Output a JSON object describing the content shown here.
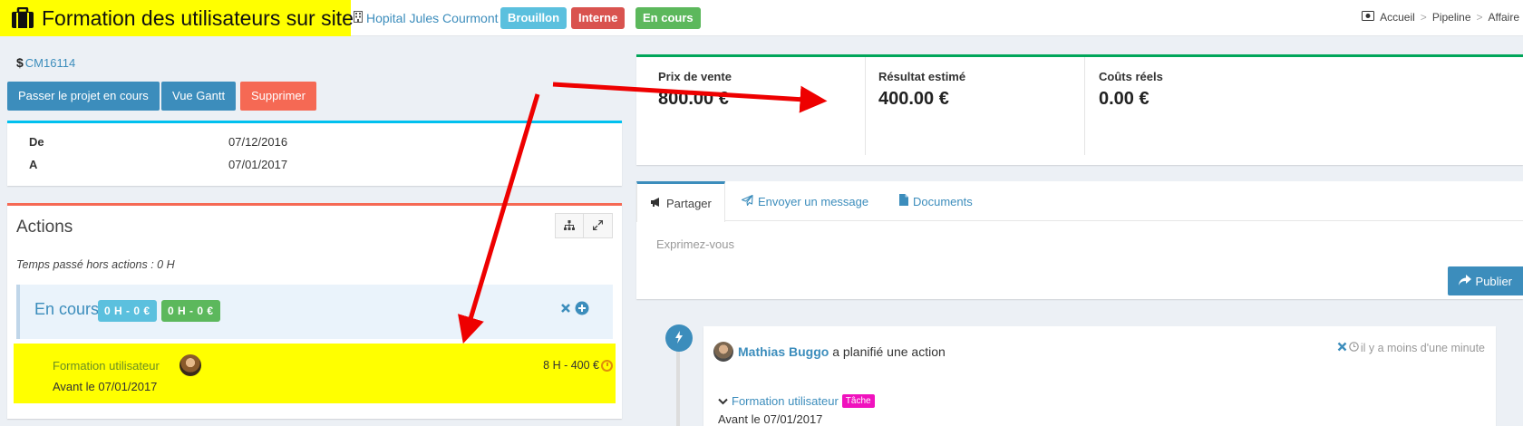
{
  "header": {
    "title": "Formation des utilisateurs sur site",
    "thirdparty": "Hopital Jules Courmont",
    "badges": [
      "Brouillon",
      "Interne",
      "En cours"
    ],
    "breadcrumb": [
      "Accueil",
      "Pipeline",
      "Affaire"
    ]
  },
  "project": {
    "ref": "CM16114",
    "buttons": {
      "start": "Passer le projet en cours",
      "gantt": "Vue Gantt",
      "delete": "Supprimer"
    },
    "dates": {
      "from_label": "De",
      "from_value": "07/12/2016",
      "to_label": "A",
      "to_value": "07/01/2017"
    }
  },
  "actions": {
    "title": "Actions",
    "time_outside": "Temps passé hors actions : 0 H",
    "status": {
      "title": "En cours",
      "pill_a": "0 H - 0 €",
      "pill_b": "0 H - 0 €"
    },
    "task": {
      "name": "Formation utilisateur",
      "deadline": "Avant le 07/01/2017",
      "cost": "8 H - 400 €"
    }
  },
  "kpis": [
    {
      "label": "Prix de vente",
      "value": "800.00 €"
    },
    {
      "label": "Résultat estimé",
      "value": "400.00 €"
    },
    {
      "label": "Coûts réels",
      "value": "0.00 €"
    }
  ],
  "feed": {
    "tabs": [
      "Partager",
      "Envoyer un message",
      "Documents"
    ],
    "placeholder": "Exprimez-vous",
    "publish": "Publier"
  },
  "event": {
    "user": "Mathias Buggo",
    "text": "a planifié une action",
    "time": "il y a moins d'une minute",
    "task": "Formation utilisateur",
    "tag": "Tâche",
    "deadline": "Avant le 07/01/2017"
  },
  "colors": {
    "accent": "#3c8dbc",
    "highlight": "#ffff00",
    "danger": "#f56954",
    "success": "#5cb85c",
    "info": "#5bc0de"
  }
}
